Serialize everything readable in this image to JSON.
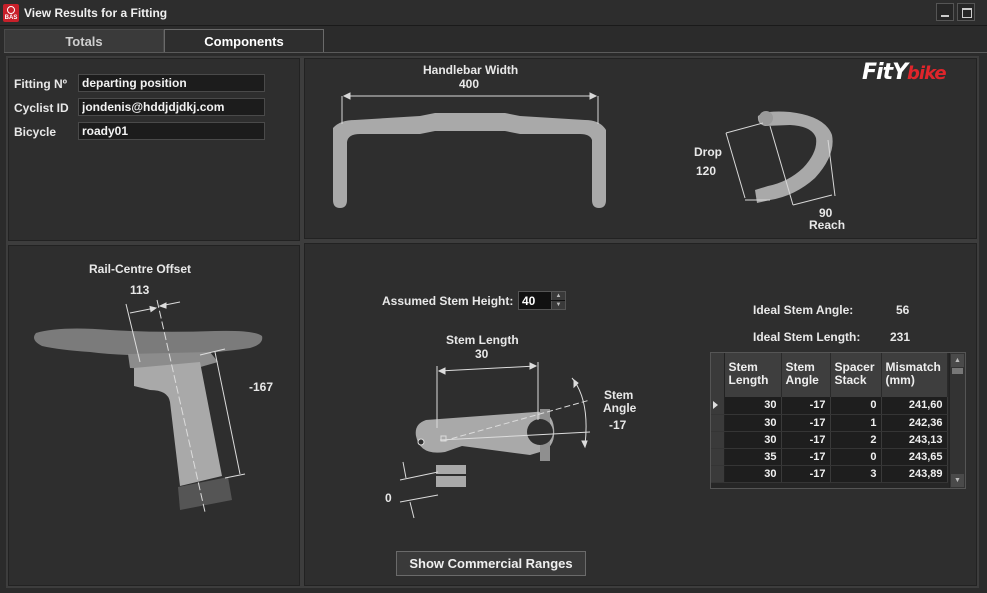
{
  "window": {
    "title": "View Results for a Fitting",
    "icon_text": "BAS"
  },
  "tabs": [
    {
      "label": "Totals"
    },
    {
      "label": "Components"
    }
  ],
  "fitting": {
    "fitting_label": "Fitting Nº",
    "fitting_value": "departing position",
    "cyclist_label": "Cyclist ID",
    "cyclist_value": "jondenis@hddjdjdkj.com",
    "bicycle_label": "Bicycle",
    "bicycle_value": "roady01"
  },
  "logo": {
    "fit_text": "FitY",
    "bike_text": "bike",
    "accent": "#e0252b"
  },
  "handlebar": {
    "width_label": "Handlebar Width",
    "width_value": "400",
    "drop_label": "Drop",
    "drop_value": "120",
    "reach_value": "90",
    "reach_label": "Reach"
  },
  "saddle": {
    "title": "Rail-Centre Offset",
    "offset_value": "113",
    "height_value": "-167"
  },
  "stem": {
    "assumed_height_label": "Assumed Stem Height:",
    "assumed_height_value": "40",
    "length_label": "Stem Length",
    "length_value": "30",
    "angle_label_1": "Stem",
    "angle_label_2": "Angle",
    "angle_value": "-17",
    "spacer_value": "0",
    "ideal_angle_label": "Ideal Stem Angle:",
    "ideal_angle_value": "56",
    "ideal_length_label": "Ideal Stem Length:",
    "ideal_length_value": "231"
  },
  "grid": {
    "headers": [
      {
        "l1": "Stem",
        "l2": "Length"
      },
      {
        "l1": "Stem",
        "l2": "Angle"
      },
      {
        "l1": "Spacer",
        "l2": "Stack"
      },
      {
        "l1": "Mismatch",
        "l2": "(mm)"
      }
    ],
    "rows": [
      [
        "30",
        "-17",
        "0",
        "241,60"
      ],
      [
        "30",
        "-17",
        "1",
        "242,36"
      ],
      [
        "30",
        "-17",
        "2",
        "243,13"
      ],
      [
        "35",
        "-17",
        "0",
        "243,65"
      ],
      [
        "30",
        "-17",
        "3",
        "243,89"
      ]
    ]
  },
  "actions": {
    "commercial_button": "Show Commercial Ranges"
  }
}
